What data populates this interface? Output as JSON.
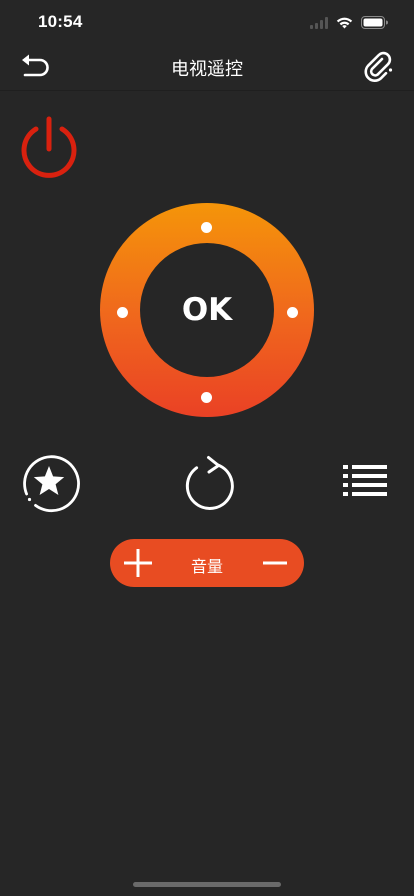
{
  "status_bar": {
    "time": "10:54",
    "icons": [
      "signal-icon",
      "wifi-icon",
      "battery-icon"
    ]
  },
  "nav": {
    "title": "电视遥控",
    "back_icon": "undo-arrow-icon",
    "link_icon": "paperclip-icon"
  },
  "remote": {
    "power_icon": "power-icon",
    "ok_label": "OK",
    "dpad_icons": [
      "up-dot",
      "down-dot",
      "left-dot",
      "right-dot"
    ],
    "favorite_icon": "star-circle-icon",
    "return_icon": "return-arrow-icon",
    "menu_icon": "list-menu-icon",
    "volume": {
      "label": "音量",
      "plus_icon": "plus-icon",
      "minus_icon": "minus-icon"
    }
  },
  "colors": {
    "background": "#262626",
    "power_red": "#d9210f",
    "dpad_top": "#f59509",
    "dpad_bottom": "#ea4125",
    "volume_bar": "#e84c22",
    "foreground": "#ffffff"
  }
}
